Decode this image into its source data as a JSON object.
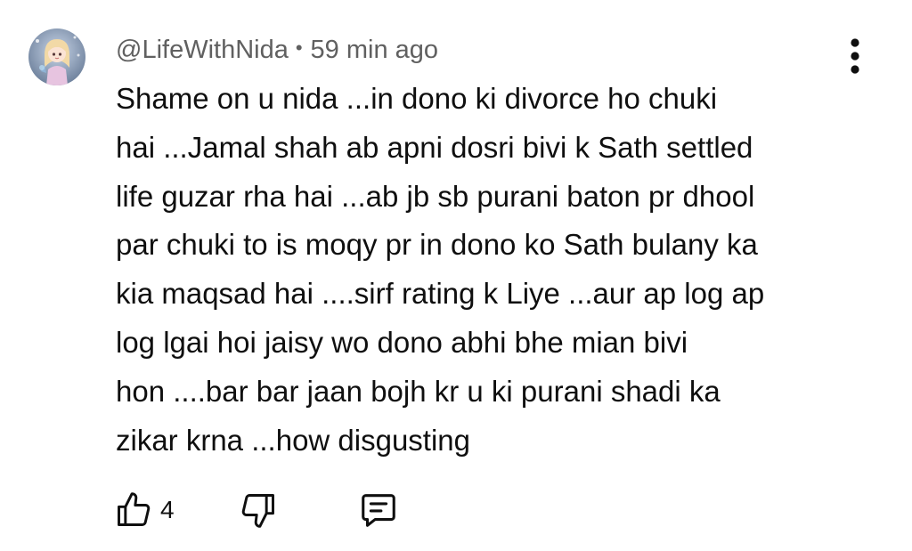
{
  "comment": {
    "author": "@LifeWithNida",
    "separator": "•",
    "timestamp": "59 min ago",
    "text": "Shame on u nida ...in dono ki divorce ho chuki\nhai ...Jamal shah ab apni dosri bivi k Sath settled\nlife guzar rha hai ...ab jb sb purani baton pr dhool\npar chuki to is moqy pr in dono ko Sath bulany ka\nkia maqsad hai ....sirf rating k Liye ...aur ap log ap\nlog lgai hoi jaisy wo dono abhi bhe mian bivi\nhon ....bar bar jaan bojh kr u ki purani shadi ka\nzikar krna ...how disgusting",
    "like_count": "4"
  },
  "icons": {
    "avatar": "avatar-image",
    "menu": "more-vertical-icon",
    "like": "thumbs-up-icon",
    "dislike": "thumbs-down-icon",
    "reply": "comment-icon"
  },
  "colors": {
    "text_primary": "#0f0f0f",
    "text_secondary": "#606060",
    "background": "#ffffff"
  }
}
